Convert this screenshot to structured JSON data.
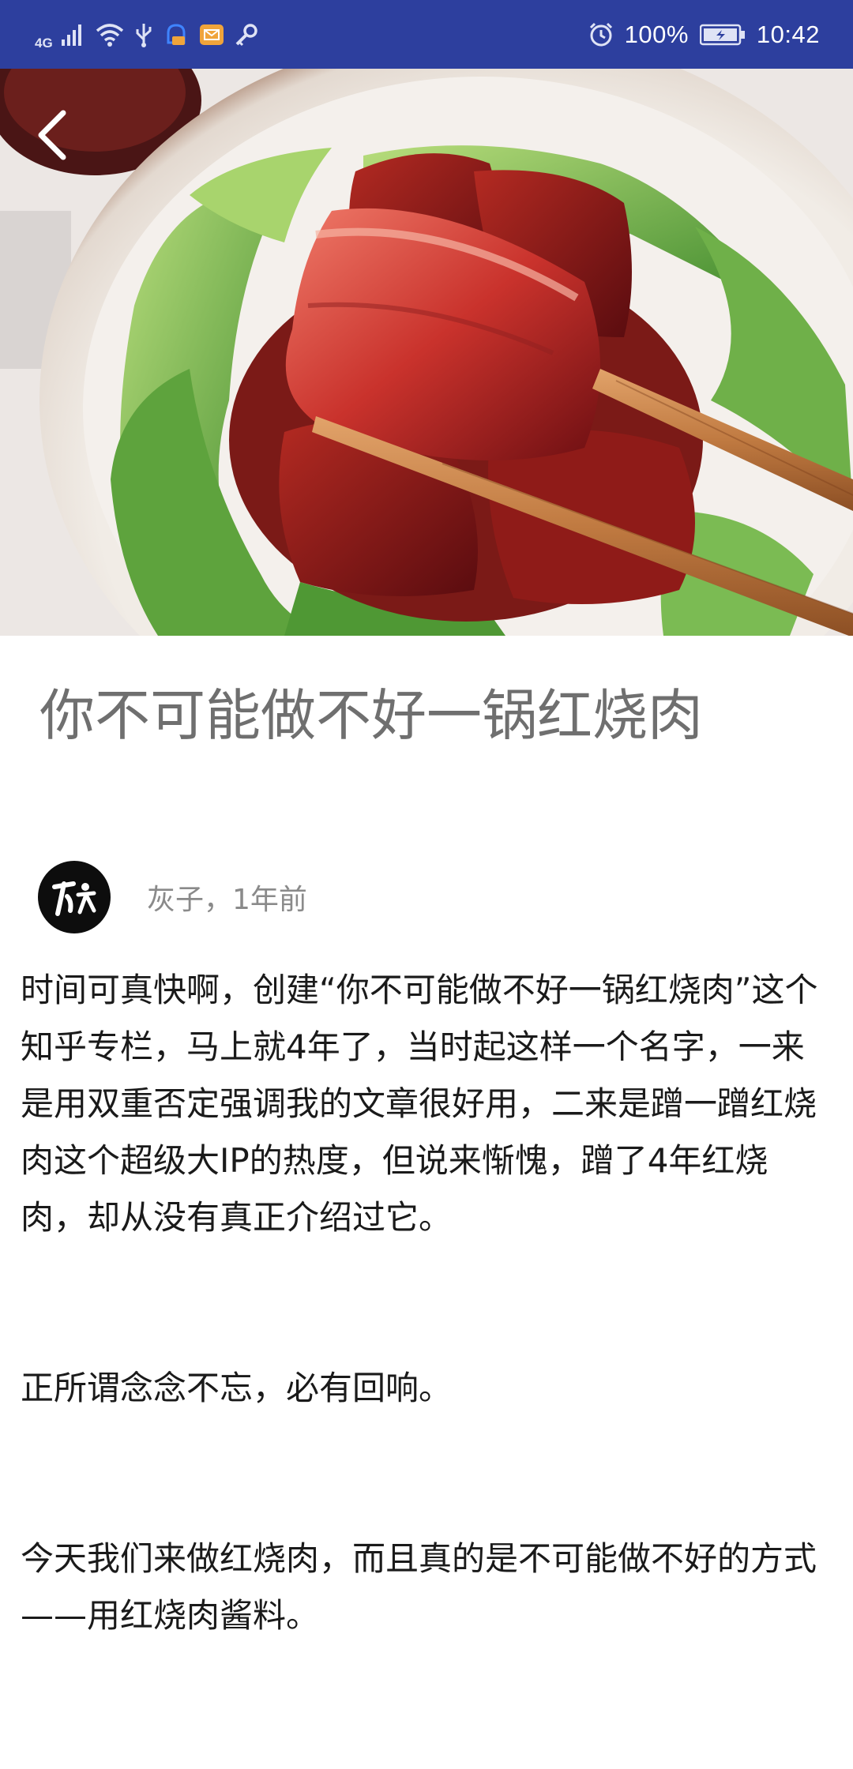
{
  "status_bar": {
    "network_type": "4G",
    "battery_percent": "100%",
    "time": "10:42",
    "icons": [
      "signal-icon",
      "wifi-icon",
      "usb-icon",
      "notification-icon",
      "mail-icon",
      "key-icon",
      "alarm-icon",
      "battery-icon"
    ],
    "background_color": "#2d3f9e"
  },
  "hero": {
    "image_subject": "red-braised-pork-with-bok-choy",
    "back_icon": "chevron-left-icon"
  },
  "article": {
    "title": "你不可能做不好一锅红烧肉",
    "author": "灰子",
    "time_ago": "1年前",
    "author_meta": "灰子，1年前",
    "avatar_icon": "author-logo-icon",
    "paragraphs": [
      "时间可真快啊，创建“你不可能做不好一锅红烧肉”这个知乎专栏，马上就4年了，当时起这样一个名字，一来是用双重否定强调我的文章很好用，二来是蹭一蹭红烧肉这个超级大IP的热度，但说来惭愧，蹭了4年红烧肉，却从没有真正介绍过它。",
      "正所谓念念不忘，必有回响。",
      "今天我们来做红烧肉，而且真的是不可能做不好的方式——用红烧肉酱料。"
    ]
  }
}
